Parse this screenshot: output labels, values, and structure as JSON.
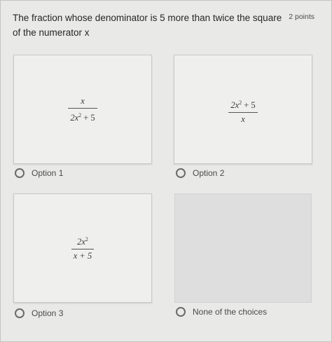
{
  "question": {
    "title": "The fraction whose denominator is 5 more than twice the square of the numerator x",
    "points": "2 points"
  },
  "options": [
    {
      "label": "Option 1",
      "fraction": {
        "num": "x",
        "den_main": "2x",
        "den_sup": "2",
        "den_tail": " + 5"
      }
    },
    {
      "label": "Option 2",
      "fraction": {
        "num_main": "2x",
        "num_sup": "2",
        "num_tail": " + 5",
        "den": "x"
      }
    },
    {
      "label": "Option 3",
      "fraction": {
        "num_main": "2x",
        "num_sup": "2",
        "den": "x + 5"
      }
    },
    {
      "label": "None of the choices"
    }
  ]
}
